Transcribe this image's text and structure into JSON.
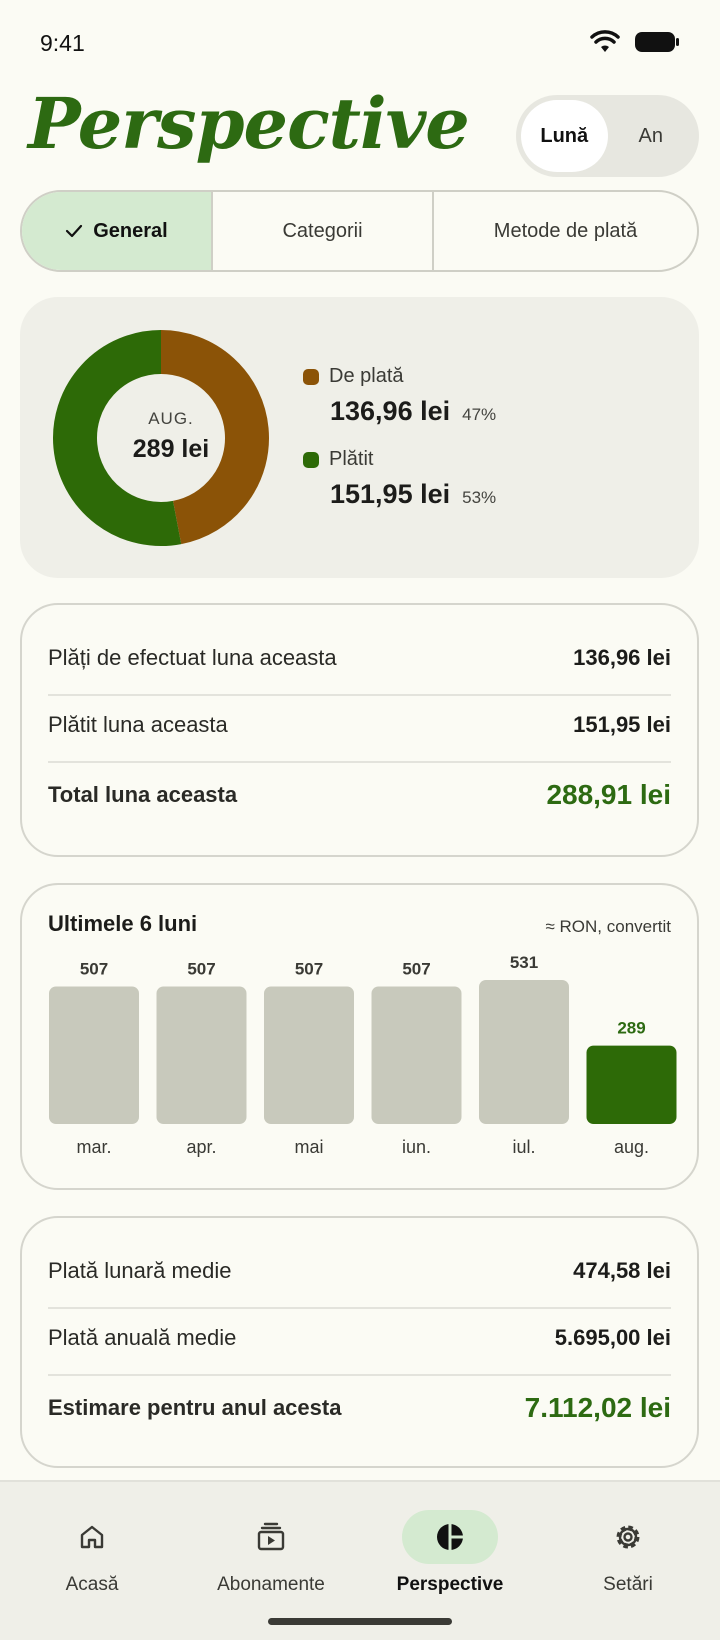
{
  "status": {
    "time": "9:41"
  },
  "app": {
    "title": "Perspective"
  },
  "period_toggle": {
    "options": [
      "Lună",
      "An"
    ],
    "selected": "Lună"
  },
  "tabs": [
    {
      "label": "General",
      "active": true
    },
    {
      "label": "Categorii",
      "active": false
    },
    {
      "label": "Metode de plată",
      "active": false
    }
  ],
  "summary": {
    "month": "AUG.",
    "total": "289 lei",
    "legend": [
      {
        "label": "De plată",
        "amount": "136,96 lei",
        "pct": "47%",
        "fraction": 0.47,
        "color": "#8b5307"
      },
      {
        "label": "Plătit",
        "amount": "151,95 lei",
        "pct": "53%",
        "fraction": 0.53,
        "color": "#2d6a07"
      }
    ]
  },
  "month_totals": {
    "rows": [
      {
        "label": "Plăți de efectuat luna aceasta",
        "value": "136,96 lei"
      },
      {
        "label": "Plătit luna aceasta",
        "value": "151,95 lei"
      }
    ],
    "total": {
      "label": "Total luna aceasta",
      "value": "288,91 lei"
    }
  },
  "chart_data": {
    "type": "bar",
    "title": "Ultimele 6 luni",
    "note": "≈ RON, convertit",
    "categories": [
      "mar.",
      "apr.",
      "mai",
      "iun.",
      "iul.",
      "aug."
    ],
    "values": [
      507,
      507,
      507,
      507,
      531,
      289
    ],
    "highlight_index": 5,
    "colors": {
      "default": "#c8c9bc",
      "highlight": "#2d6a07",
      "highlight_label": "#2d6a12"
    }
  },
  "averages": {
    "rows": [
      {
        "label": "Plată lunară medie",
        "value": "474,58 lei"
      },
      {
        "label": "Plată anuală medie",
        "value": "5.695,00 lei"
      }
    ],
    "total": {
      "label": "Estimare pentru anul acesta",
      "value": "7.112,02 lei"
    }
  },
  "nav": {
    "items": [
      {
        "label": "Acasă",
        "icon": "home-icon",
        "active": false
      },
      {
        "label": "Abonamente",
        "icon": "subscriptions-icon",
        "active": false
      },
      {
        "label": "Perspective",
        "icon": "pie-chart-icon",
        "active": true
      },
      {
        "label": "Setări",
        "icon": "gear-icon",
        "active": false
      }
    ]
  }
}
